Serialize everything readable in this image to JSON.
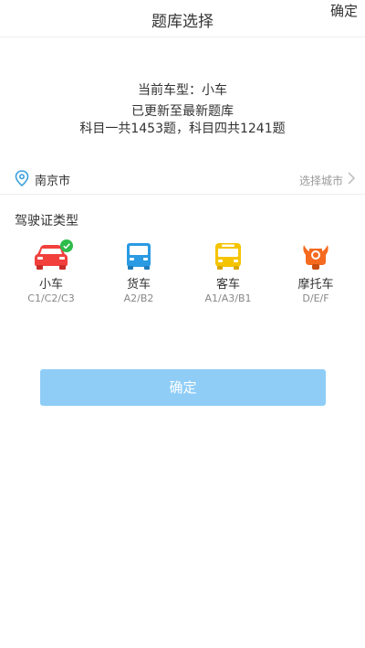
{
  "header": {
    "title": "题库选择",
    "confirm": "确定"
  },
  "info": {
    "current_type": "当前车型：小车",
    "update_status": "已更新至最新题库",
    "counts": "科目一共1453题，科目四共1241题"
  },
  "city": {
    "name": "南京市",
    "choose_label": "选择城市"
  },
  "license_section": {
    "title": "驾驶证类型"
  },
  "types": [
    {
      "name": "小车",
      "code": "C1/C2/C3",
      "icon": "car-icon",
      "color": "#f2403d",
      "selected": true
    },
    {
      "name": "货车",
      "code": "A2/B2",
      "icon": "truck-icon",
      "color": "#2a9ae3",
      "selected": false
    },
    {
      "name": "客车",
      "code": "A1/A3/B1",
      "icon": "bus-icon",
      "color": "#f5c400",
      "selected": false
    },
    {
      "name": "摩托车",
      "code": "D/E/F",
      "icon": "motorcycle-icon",
      "color": "#f56a1e",
      "selected": false
    }
  ],
  "button": {
    "label": "确定"
  },
  "colors": {
    "accent_button": "#8fcdf7",
    "check": "#2dbb4a"
  }
}
